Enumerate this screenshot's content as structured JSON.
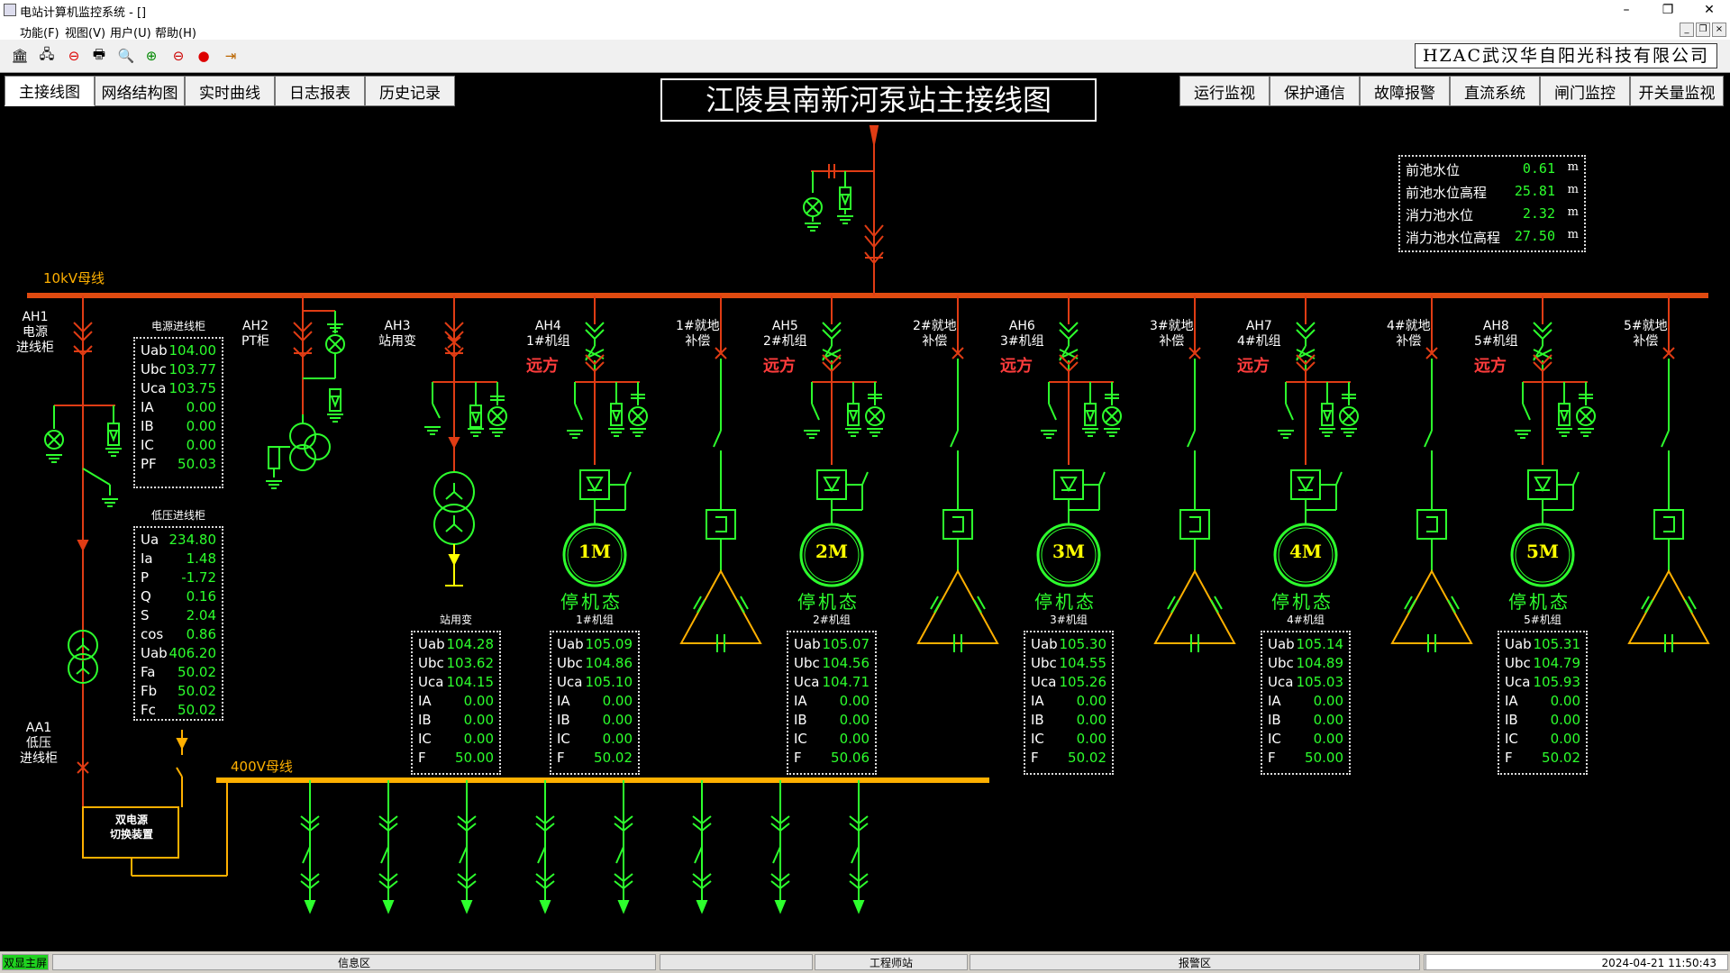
{
  "window": {
    "title": "电站计算机监控系统 - []"
  },
  "menu": [
    {
      "label": "功能(F)"
    },
    {
      "label": "视图(V)"
    },
    {
      "label": "用户(U)"
    },
    {
      "label": "帮助(H)"
    }
  ],
  "brand": "HZAC武汉华自阳光科技有限公司",
  "nav_left": [
    {
      "label": "主接线图"
    },
    {
      "label": "网络结构图"
    },
    {
      "label": "实时曲线"
    },
    {
      "label": "日志报表"
    },
    {
      "label": "历史记录"
    }
  ],
  "nav_right": [
    {
      "label": "运行监视"
    },
    {
      "label": "保护通信"
    },
    {
      "label": "故障报警"
    },
    {
      "label": "直流系统"
    },
    {
      "label": "闸门监控"
    },
    {
      "label": "开关量监视"
    }
  ],
  "diagram_title": "江陵县南新河泵站主接线图",
  "bus_10kv": "10kV母线",
  "bus_400v": "400V母线",
  "water": [
    {
      "label": "前池水位",
      "value": "0.61",
      "unit": "m"
    },
    {
      "label": "前池水位高程",
      "value": "25.81",
      "unit": "m"
    },
    {
      "label": "消力池水位",
      "value": "2.32",
      "unit": "m"
    },
    {
      "label": "消力池水位高程",
      "value": "27.50",
      "unit": "m"
    }
  ],
  "power_in": {
    "title": "电源进线柜",
    "rows": [
      {
        "k": "Uab",
        "v": "104.00"
      },
      {
        "k": "Ubc",
        "v": "103.77"
      },
      {
        "k": "Uca",
        "v": "103.75"
      },
      {
        "k": "IA",
        "v": "0.00"
      },
      {
        "k": "IB",
        "v": "0.00"
      },
      {
        "k": "IC",
        "v": "0.00"
      },
      {
        "k": "PF",
        "v": "50.03"
      }
    ]
  },
  "lv_in": {
    "title": "低压进线柜",
    "rows": [
      {
        "k": "Ua",
        "v": "234.80"
      },
      {
        "k": "Ia",
        "v": "1.48"
      },
      {
        "k": "P",
        "v": "-1.72"
      },
      {
        "k": "Q",
        "v": "0.16"
      },
      {
        "k": "S",
        "v": "2.04"
      },
      {
        "k": "cos",
        "v": "0.86"
      },
      {
        "k": "Uab",
        "v": "406.20"
      },
      {
        "k": "Fa",
        "v": "50.02"
      },
      {
        "k": "Fb",
        "v": "50.02"
      },
      {
        "k": "Fc",
        "v": "50.02"
      }
    ]
  },
  "station_tf": {
    "title": "站用变",
    "rows": [
      {
        "k": "Uab",
        "v": "104.28"
      },
      {
        "k": "Ubc",
        "v": "103.62"
      },
      {
        "k": "Uca",
        "v": "104.15"
      },
      {
        "k": "IA",
        "v": "0.00"
      },
      {
        "k": "IB",
        "v": "0.00"
      },
      {
        "k": "IC",
        "v": "0.00"
      },
      {
        "k": "F",
        "v": "50.00"
      }
    ]
  },
  "units": [
    {
      "title": "1#机组",
      "motor": "1M",
      "state": "停机态",
      "remote": "远方",
      "cab": "AH4",
      "name": "1#机组",
      "comp": "1#就地",
      "rows": [
        {
          "k": "Uab",
          "v": "105.09"
        },
        {
          "k": "Ubc",
          "v": "104.86"
        },
        {
          "k": "Uca",
          "v": "105.10"
        },
        {
          "k": "IA",
          "v": "0.00"
        },
        {
          "k": "IB",
          "v": "0.00"
        },
        {
          "k": "IC",
          "v": "0.00"
        },
        {
          "k": "F",
          "v": "50.02"
        }
      ]
    },
    {
      "title": "2#机组",
      "motor": "2M",
      "state": "停机态",
      "remote": "远方",
      "cab": "AH5",
      "name": "2#机组",
      "comp": "2#就地",
      "rows": [
        {
          "k": "Uab",
          "v": "105.07"
        },
        {
          "k": "Ubc",
          "v": "104.56"
        },
        {
          "k": "Uca",
          "v": "104.71"
        },
        {
          "k": "IA",
          "v": "0.00"
        },
        {
          "k": "IB",
          "v": "0.00"
        },
        {
          "k": "IC",
          "v": "0.00"
        },
        {
          "k": "F",
          "v": "50.06"
        }
      ]
    },
    {
      "title": "3#机组",
      "motor": "3M",
      "state": "停机态",
      "remote": "远方",
      "cab": "AH6",
      "name": "3#机组",
      "comp": "3#就地",
      "rows": [
        {
          "k": "Uab",
          "v": "105.30"
        },
        {
          "k": "Ubc",
          "v": "104.55"
        },
        {
          "k": "Uca",
          "v": "105.26"
        },
        {
          "k": "IA",
          "v": "0.00"
        },
        {
          "k": "IB",
          "v": "0.00"
        },
        {
          "k": "IC",
          "v": "0.00"
        },
        {
          "k": "F",
          "v": "50.02"
        }
      ]
    },
    {
      "title": "4#机组",
      "motor": "4M",
      "state": "停机态",
      "remote": "远方",
      "cab": "AH7",
      "name": "4#机组",
      "comp": "4#就地",
      "rows": [
        {
          "k": "Uab",
          "v": "105.14"
        },
        {
          "k": "Ubc",
          "v": "104.89"
        },
        {
          "k": "Uca",
          "v": "105.03"
        },
        {
          "k": "IA",
          "v": "0.00"
        },
        {
          "k": "IB",
          "v": "0.00"
        },
        {
          "k": "IC",
          "v": "0.00"
        },
        {
          "k": "F",
          "v": "50.00"
        }
      ]
    },
    {
      "title": "5#机组",
      "motor": "5M",
      "state": "停机态",
      "remote": "远方",
      "cab": "AH8",
      "name": "5#机组",
      "comp": "5#就地",
      "rows": [
        {
          "k": "Uab",
          "v": "105.31"
        },
        {
          "k": "Ubc",
          "v": "104.79"
        },
        {
          "k": "Uca",
          "v": "105.93"
        },
        {
          "k": "IA",
          "v": "0.00"
        },
        {
          "k": "IB",
          "v": "0.00"
        },
        {
          "k": "IC",
          "v": "0.00"
        },
        {
          "k": "F",
          "v": "50.02"
        }
      ]
    }
  ],
  "labels": {
    "ah1_code": "AH1",
    "ah1_l2": "电源",
    "ah1_l3": "进线柜",
    "ah2_code": "AH2",
    "ah2_l2": "PT柜",
    "ah3_code": "AH3",
    "ah3_l2": "站用变",
    "aa1_code": "AA1",
    "aa1_l2": "低压",
    "aa1_l3": "进线柜",
    "comp_suffix": "补偿",
    "dual_l1": "双电源",
    "dual_l2": "切换装置"
  },
  "status": {
    "mode": "双显主屏",
    "info": "信息区",
    "station": "工程师站",
    "alarm": "报警区",
    "time": "2024-04-21 11:50:43"
  },
  "colors": {
    "bus10": "#e04a10",
    "bus400": "#ffb000",
    "energized": "#e03c14",
    "deenergized": "#2dff2d",
    "value": "#2dff2d",
    "remote": "#ff3c3c"
  }
}
